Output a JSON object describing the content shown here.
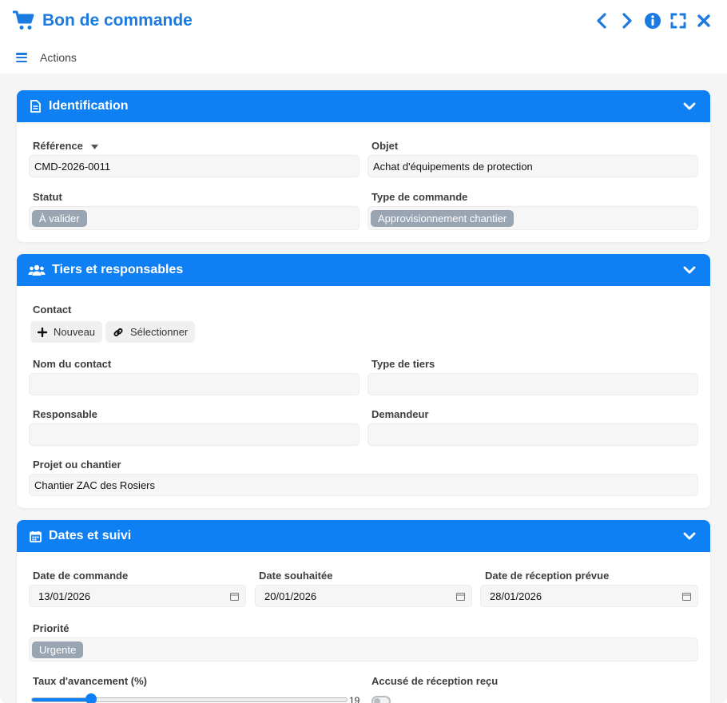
{
  "window": {
    "title": "Bon de commande"
  },
  "toolbar": {
    "actions_label": "Actions"
  },
  "sections": {
    "identification": {
      "title": "Identification",
      "reference_label": "Référence",
      "reference_value": "CMD-2026-0011",
      "objet_label": "Objet",
      "objet_value": "Achat d'équipements de protection",
      "statut_label": "Statut",
      "statut_value": "À valider",
      "type_label": "Type de commande",
      "type_value": "Approvisionnement chantier"
    },
    "tiers": {
      "title": "Tiers et responsables",
      "contact_label": "Contact",
      "nouveau_label": "Nouveau",
      "selectionner_label": "Sélectionner",
      "nom_contact_label": "Nom du contact",
      "nom_contact_value": "",
      "type_tiers_label": "Type de tiers",
      "type_tiers_value": "",
      "responsable_label": "Responsable",
      "responsable_value": "",
      "demandeur_label": "Demandeur",
      "demandeur_value": "",
      "projet_label": "Projet ou chantier",
      "projet_value": "Chantier ZAC des Rosiers"
    },
    "dates": {
      "title": "Dates et suivi",
      "date_commande_label": "Date de commande",
      "date_commande_value": "13/01/2026",
      "date_souhaitee_label": "Date souhaitée",
      "date_souhaitee_value": "20/01/2026",
      "date_reception_label": "Date de réception prévue",
      "date_reception_value": "28/01/2026",
      "priorite_label": "Priorité",
      "priorite_value": "Urgente",
      "avancement_label": "Taux d'avancement (%)",
      "avancement_value": 19,
      "avancement_text": "19",
      "accuse_label": "Accusé de réception reçu",
      "accuse_value": false
    }
  },
  "colors": {
    "accent": "#0f7ff4",
    "title": "#1a7ae0",
    "badge": "#9aa5b4"
  },
  "icons": {
    "window": "cart-icon",
    "header": [
      "chevron-left-icon",
      "chevron-right-icon",
      "info-icon",
      "expand-icon",
      "close-icon"
    ],
    "menu": "menu-icon",
    "identification": "document-icon",
    "tiers": "users-icon",
    "dates": "calendar-icon"
  }
}
